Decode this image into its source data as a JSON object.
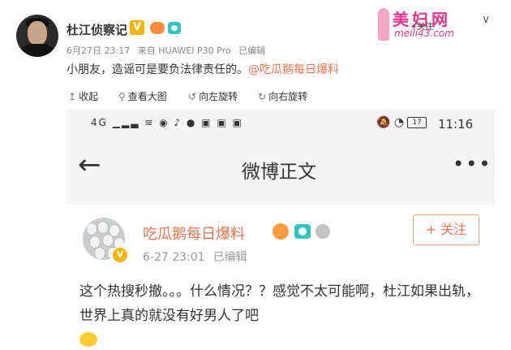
{
  "post": {
    "username": "杜江侦察记",
    "verified_mark": "V",
    "date": "6月27日 23:17",
    "source": "来自 HUAWEI P30 Pro",
    "edited": "已编辑",
    "text": "小朋友，造谣可是要负法律责任的。",
    "mention": "@吃瓜鹅每日爆料"
  },
  "watermark": {
    "title": "美妇网",
    "follow": "+关注",
    "url": "meili43.com"
  },
  "toolbar": {
    "collapse": "收起",
    "view_large": "查看大图",
    "rotate_left": "向左旋转",
    "rotate_right": "向右旋转"
  },
  "phone": {
    "network": "4G",
    "time": "11:16",
    "battery": "17",
    "nav_title": "微博正文",
    "back_glyph": "←",
    "more_glyph": "•••",
    "card": {
      "name": "吃瓜鹅每日爆料",
      "verified_mark": "V",
      "date": "6-27 23:01",
      "edited": "已编辑",
      "follow_label": "+ 关注",
      "text": "这个热搜秒撤。。。什么情况？？感觉不太可能啊，杜江如果出轨，世界上真的就没有好男人了吧"
    }
  }
}
